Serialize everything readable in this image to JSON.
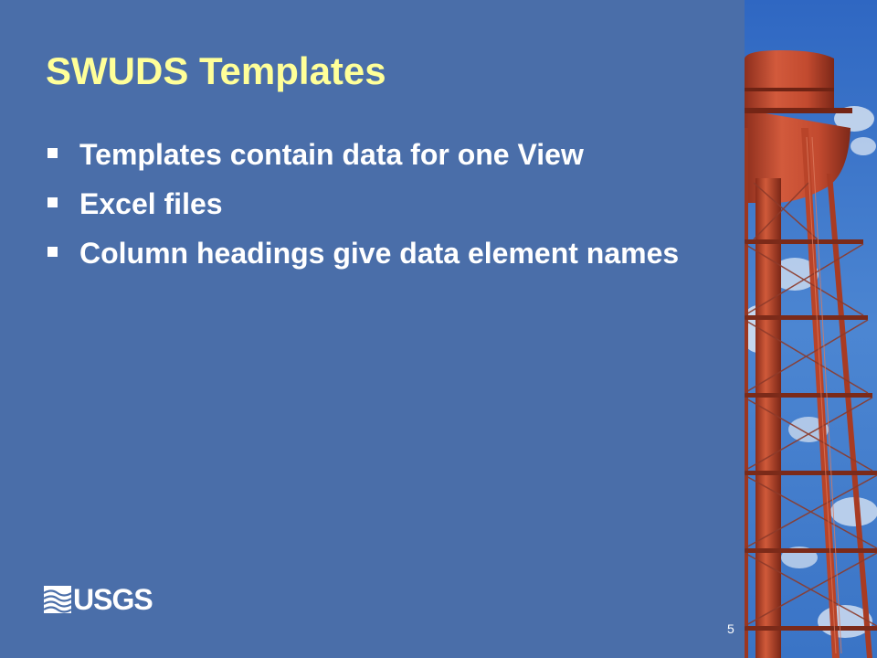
{
  "slide": {
    "title": "SWUDS Templates",
    "bullets": [
      "Templates contain data for one View",
      "Excel files",
      "Column headings give data element names"
    ],
    "logo_text": "USGS",
    "page_number": "5",
    "photo_subject": "water-tower-photo"
  },
  "colors": {
    "background": "#4a6ea9",
    "title": "#ffff99",
    "body_text": "#ffffff",
    "tower": "#c0472e",
    "sky": "#3f78c8"
  }
}
